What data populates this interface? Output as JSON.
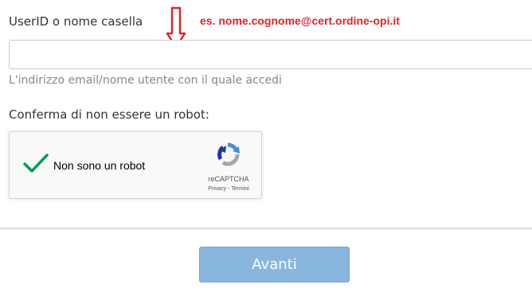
{
  "form": {
    "userid_label": "UserID o nome casella",
    "userid_value": "",
    "userid_help": "L'indirizzo email/nome utente con il quale accedi",
    "robot_label": "Conferma di non essere un robot:",
    "submit_label": "Avanti"
  },
  "annotation": {
    "text": "es. nome.cognome@cert.ordine-opi.it",
    "arrow_icon": "down-arrow-icon",
    "color": "#e32226"
  },
  "recaptcha": {
    "checkbox_label": "Non sono un robot",
    "checked": true,
    "brand": "reCAPTCHA",
    "privacy_link": "Privacy",
    "separator": " - ",
    "terms_link": "Termini",
    "check_icon": "checkmark-icon",
    "logo_icon": "recaptcha-logo-icon",
    "check_color": "#009e55"
  },
  "colors": {
    "button_bg": "#89b6df",
    "button_text": "#ffffff",
    "input_border": "#cccccc",
    "label_text": "#333333",
    "help_text": "#888888"
  }
}
